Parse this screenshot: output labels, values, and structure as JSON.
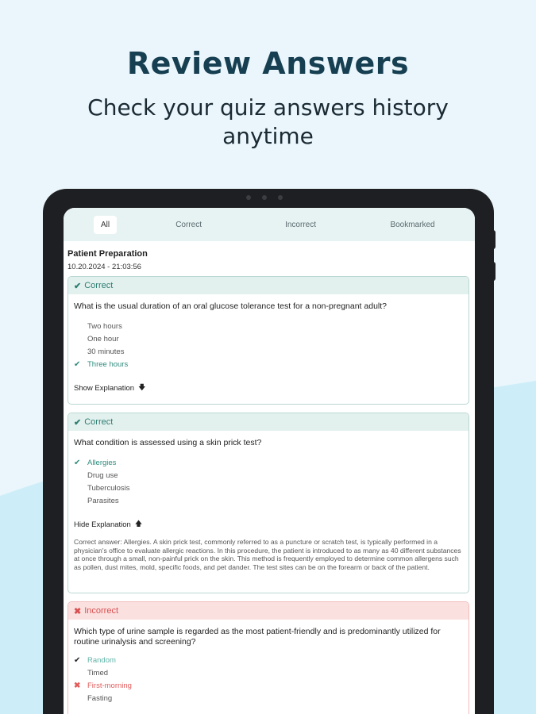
{
  "promo": {
    "headline": "Review Answers",
    "subline": "Check your quiz answers history anytime"
  },
  "tabs": [
    {
      "label": "All",
      "active": true
    },
    {
      "label": "Correct",
      "active": false
    },
    {
      "label": "Incorrect",
      "active": false
    },
    {
      "label": "Bookmarked",
      "active": false
    }
  ],
  "section": {
    "title": "Patient Preparation",
    "date": "10.20.2024 - 21:03:56"
  },
  "cards": [
    {
      "status": "Correct",
      "question": "What is the usual duration of an oral glucose tolerance test for a non-pregnant adult?",
      "options": [
        "Two hours",
        "One hour",
        "30 minutes",
        "Three hours"
      ],
      "toggle": "Show Explanation"
    },
    {
      "status": "Correct",
      "question": "What condition is assessed using a skin prick test?",
      "options": [
        "Allergies",
        "Drug use",
        "Tuberculosis",
        "Parasites"
      ],
      "toggle": "Hide Explanation",
      "explanation": "Correct answer: Allergies. A skin prick test, commonly referred to as a puncture or scratch test, is typically performed in a physician's office to evaluate allergic reactions. In this procedure, the patient is introduced to as many as 40 different substances at once through a small, non-painful prick on the skin. This method is frequently employed to determine common allergens such as pollen, dust mites, mold, specific foods, and pet dander. The test sites can be on the forearm or back of the patient."
    },
    {
      "status": "Incorrect",
      "question": "Which type of urine sample is regarded as the most patient-friendly and is predominantly utilized for routine urinalysis and screening?",
      "options": [
        "Random",
        "Timed",
        "First-morning",
        "Fasting"
      ]
    }
  ],
  "colors": {
    "correct": "#2e8c7e",
    "incorrect": "#e25a5a",
    "headline": "#173f52"
  }
}
